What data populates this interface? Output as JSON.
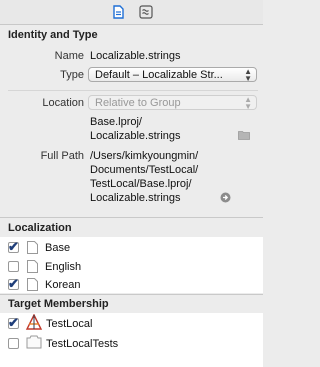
{
  "toolbar": {
    "file_icon": "file-inspector-icon",
    "help_icon": "quick-help-icon"
  },
  "identity": {
    "header": "Identity and Type",
    "name_label": "Name",
    "name_value": "Localizable.strings",
    "type_label": "Type",
    "type_value": "Default – Localizable Str...",
    "location_label": "Location",
    "location_value": "Relative to Group",
    "path_line1": "Base.lproj/",
    "path_line2": "Localizable.strings",
    "full_path_label": "Full Path",
    "full_path_line1": "/Users/kimkyoungmin/",
    "full_path_line2": "Documents/TestLocal/",
    "full_path_line3": "TestLocal/Base.lproj/",
    "full_path_line4": "Localizable.strings"
  },
  "localization": {
    "header": "Localization",
    "items": [
      {
        "label": "Base",
        "checked": true
      },
      {
        "label": "English",
        "checked": false
      },
      {
        "label": "Korean",
        "checked": true
      }
    ]
  },
  "target": {
    "header": "Target Membership",
    "items": [
      {
        "label": "TestLocal",
        "checked": true
      },
      {
        "label": "TestLocalTests",
        "checked": false
      }
    ]
  }
}
